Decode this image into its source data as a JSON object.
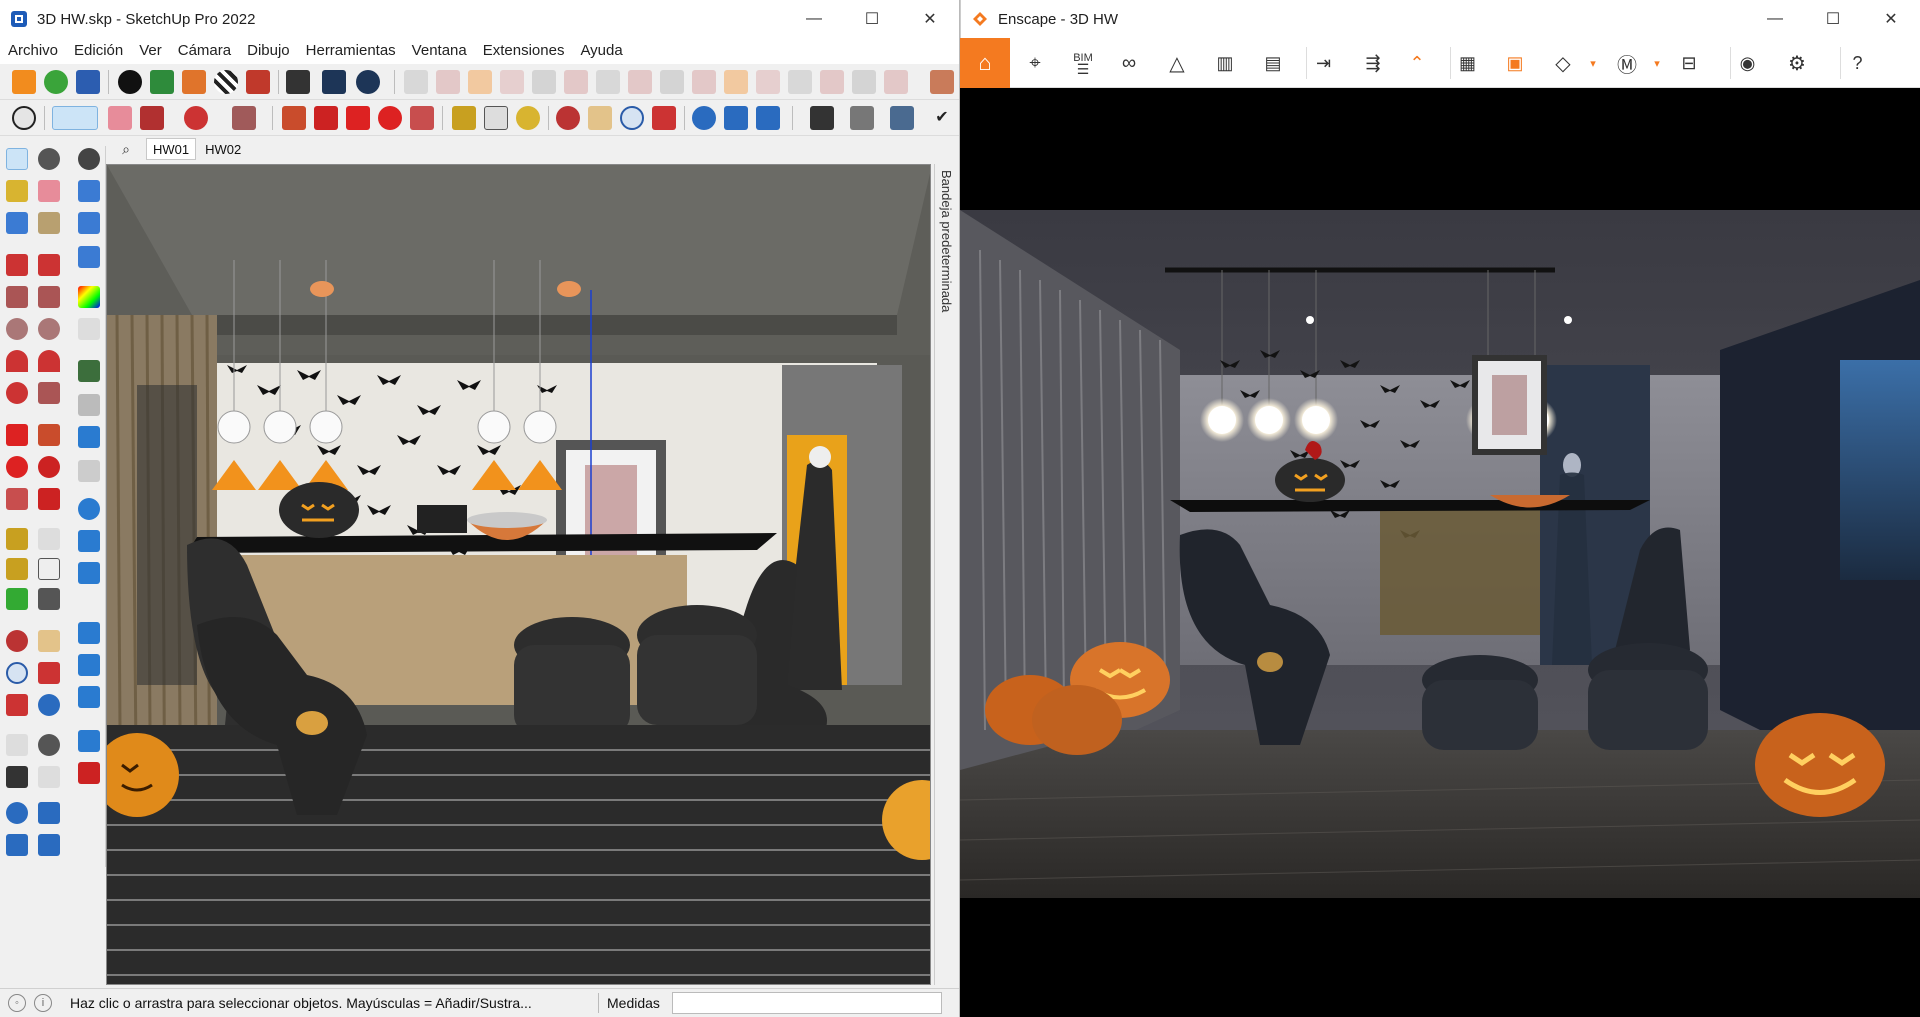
{
  "sketchup": {
    "title": "3D HW.skp - SketchUp Pro 2022",
    "menu": [
      "Archivo",
      "Edición",
      "Ver",
      "Cámara",
      "Dibujo",
      "Herramientas",
      "Ventana",
      "Extensiones",
      "Ayuda"
    ],
    "scene_tabs": [
      "HW01",
      "HW02"
    ],
    "tray_label": "Bandeja predeterminada",
    "status_text": "Haz clic o arrastra para seleccionar objetos. Mayúsculas = Añadir/Sustra...",
    "measurements_label": "Medidas",
    "measurements_value": ""
  },
  "enscape": {
    "title": "Enscape - 3D HW",
    "bim_label": "BIM"
  },
  "window_controls": {
    "minimize": "—",
    "maximize": "☐",
    "close": "✕"
  },
  "colors": {
    "enscape_orange": "#f47a20",
    "select_blue": "#cce4f7"
  },
  "icons": [
    "home-icon",
    "location-icon",
    "bim-icon",
    "binoculars-icon",
    "bell-icon",
    "buildings-icon",
    "clapperboard-icon",
    "export-icon",
    "batch-export-icon",
    "collapse-icon",
    "map-icon",
    "panorama-icon",
    "diamond-icon",
    "asset-library-icon",
    "vr-headset-icon",
    "eye-icon",
    "settings-icon",
    "help-icon"
  ]
}
